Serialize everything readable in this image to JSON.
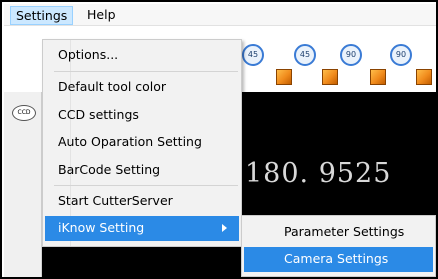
{
  "menubar": {
    "settings": "Settings",
    "help": "Help"
  },
  "toolbar": {
    "rotate_icons": [
      "45",
      "45",
      "90",
      "90"
    ],
    "rotate_icon_name": "rotate-icon",
    "cube_icon_name": "cube-icon"
  },
  "side": {
    "ccd_icon_text": "CCD"
  },
  "display": {
    "readout": "180. 9525"
  },
  "settings_menu": {
    "items": [
      "Options...",
      "Default tool color",
      "CCD settings",
      "Auto Oparation Setting",
      "BarCode Setting",
      "Start CutterServer",
      "iKnow Setting"
    ],
    "highlighted": "iKnow Setting"
  },
  "iknow_submenu": {
    "items": [
      "Parameter Settings",
      "Camera Settings"
    ],
    "highlighted": "Camera Settings"
  },
  "colors": {
    "highlight": "#2b8ae6",
    "menu_bg": "#f2f2f2",
    "display_bg": "#000000",
    "readout": "#d8d8d8"
  }
}
